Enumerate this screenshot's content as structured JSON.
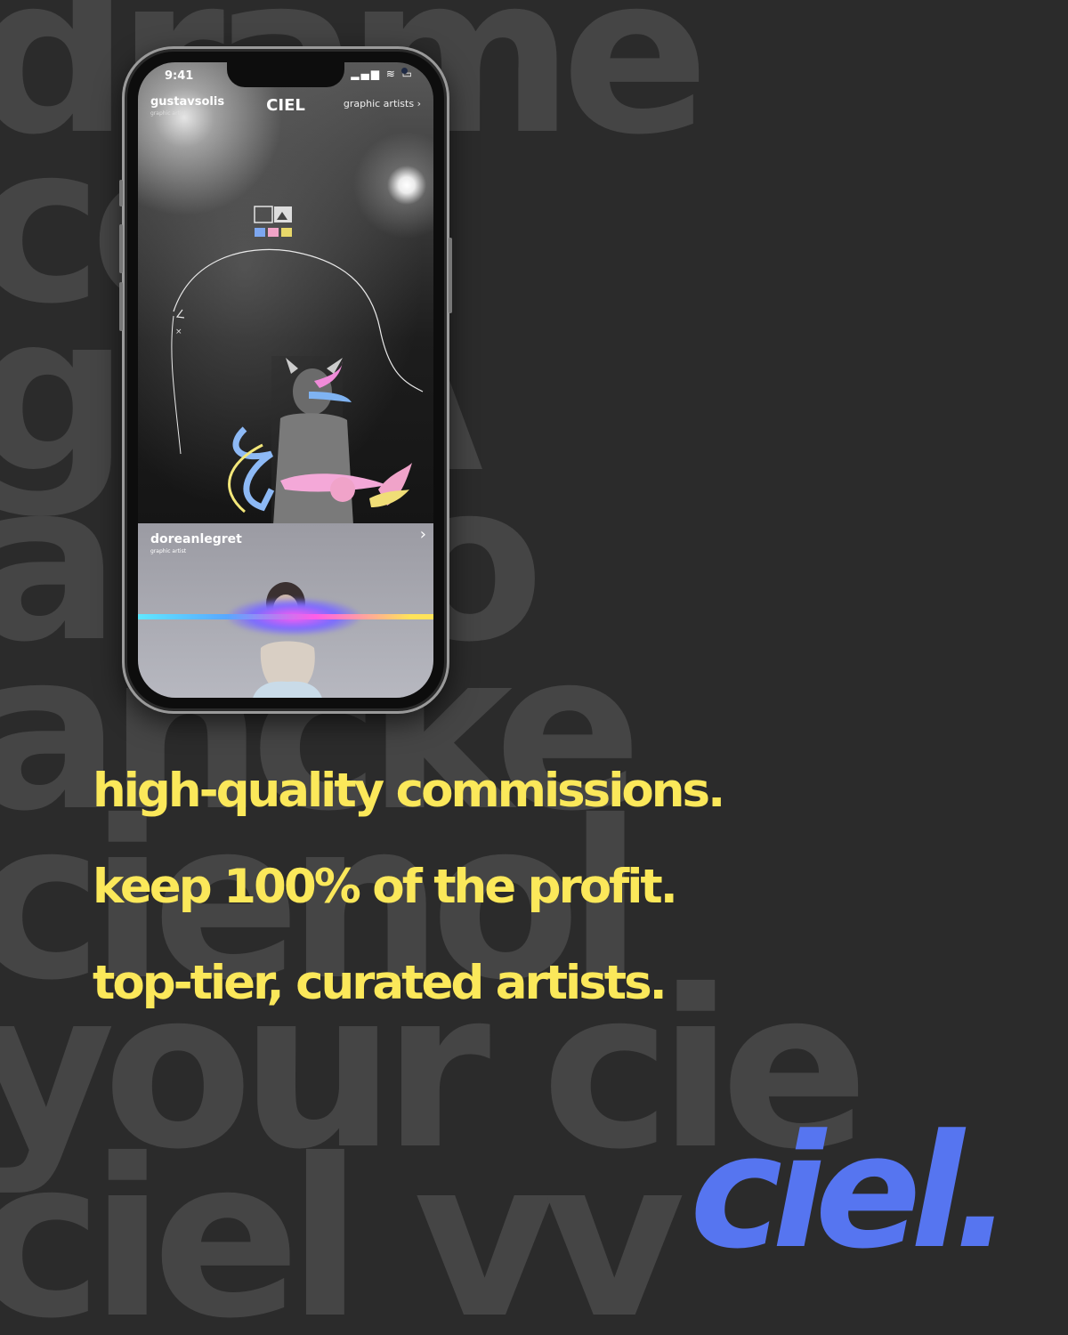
{
  "background": {
    "rows": [
      "drame",
      "ccol",
      "gieA",
      "ando",
      "ancke",
      "cienol",
      "your cie",
      "ciel vv"
    ],
    "color": "#454545",
    "base_color": "#2b2b2b"
  },
  "phone": {
    "status_time": "9:41",
    "status_icons": "▂▄▆ ≋ ▭",
    "header": {
      "username": "gustavsolis",
      "role": "graphic artist",
      "brand": "CIEL",
      "nav_link": "graphic artists",
      "nav_icon": "chevron-right-icon"
    },
    "swatch_colors": [
      "#7da7f0",
      "#f1a4c7",
      "#e8d86a"
    ],
    "second_card": {
      "username": "doreanlegret",
      "role": "graphic artist",
      "chevron": "›"
    }
  },
  "tagline": {
    "line1": "high-quality commissions.",
    "line2": "keep 100% of the profit.",
    "line3": "top-tier, curated artists."
  },
  "logo": {
    "text": "ciel.",
    "color": "#5675f0"
  },
  "accent_color": "#fbe85a"
}
